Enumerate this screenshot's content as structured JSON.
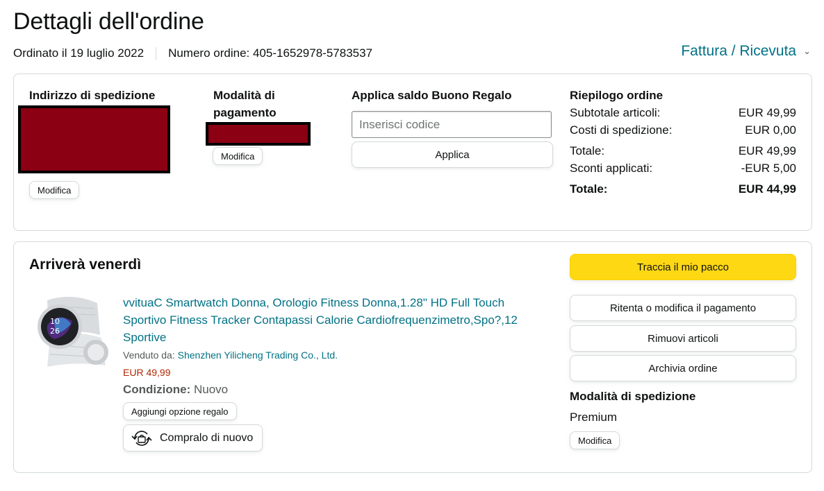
{
  "header": {
    "title": "Dettagli dell'ordine",
    "ordered_on": "Ordinato il 19 luglio 2022",
    "order_number": "Numero ordine: 405-1652978-5783537",
    "invoice_label": "Fattura / Ricevuta"
  },
  "shipping_address": {
    "title": "Indirizzo di spedizione",
    "edit_label": "Modifica"
  },
  "payment": {
    "title": "Modalità di pagamento",
    "edit_label": "Modifica"
  },
  "gift_card": {
    "title": "Applica saldo Buono Regalo",
    "placeholder": "Inserisci codice",
    "apply_label": "Applica"
  },
  "summary": {
    "title": "Riepilogo ordine",
    "subtotal_label": "Subtotale articoli:",
    "subtotal_value": "EUR 49,99",
    "shipping_label": "Costi di spedizione:",
    "shipping_value": "EUR 0,00",
    "total_label": "Totale:",
    "total_value": "EUR 49,99",
    "discount_label": "Sconti applicati:",
    "discount_value": "-EUR 5,00",
    "grand_total_label": "Totale:",
    "grand_total_value": "EUR 44,99"
  },
  "shipment": {
    "arrival": "Arriverà venerdì",
    "product": {
      "title": "vvituaC Smartwatch Donna, Orologio Fitness Donna,1.28\" HD Full Touch Sportivo Fitness Tracker Contapassi Calorie Cardiofrequenzimetro,Spo?,12 Sportive",
      "sold_by_label": "Venduto da:",
      "seller": "Shenzhen Yilicheng Trading Co., Ltd.",
      "price": "EUR 49,99",
      "condition_label": "Condizione:",
      "condition_value": "Nuovo",
      "gift_option_label": "Aggiungi opzione regalo",
      "buy_again_label": "Compralo di nuovo"
    },
    "actions": {
      "track_label": "Traccia il mio pacco",
      "retry_payment_label": "Ritenta o modifica il pagamento",
      "remove_items_label": "Rimuovi articoli",
      "archive_label": "Archivia ordine"
    },
    "shipping_method": {
      "title": "Modalità di spedizione",
      "value": "Premium",
      "edit_label": "Modifica"
    }
  },
  "colors": {
    "link": "#007185",
    "price": "#b12704",
    "primary_button": "#ffd814",
    "redaction": "#8b0012"
  }
}
